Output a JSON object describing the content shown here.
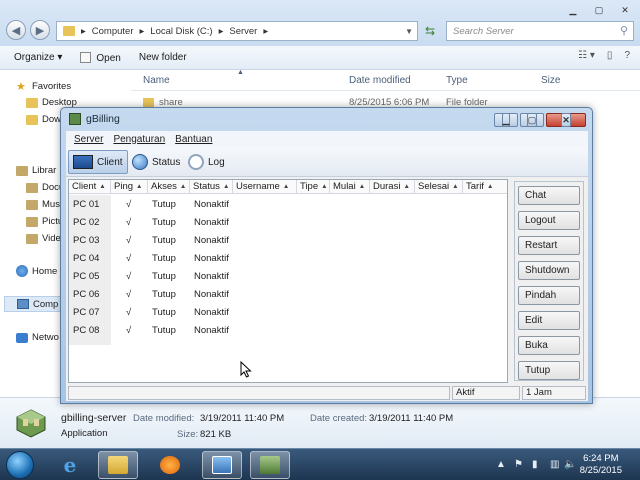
{
  "explorer": {
    "address": [
      "Computer",
      "Local Disk (C:)",
      "Server"
    ],
    "search_placeholder": "Search Server",
    "toolbar": {
      "organize": "Organize",
      "open": "Open",
      "new_folder": "New folder"
    },
    "columns": {
      "name": "Name",
      "date": "Date modified",
      "type": "Type",
      "size": "Size"
    },
    "file": {
      "name": "share",
      "date": "8/25/2015 6:06 PM",
      "type": "File folder"
    },
    "nav": {
      "favorites": "Favorites",
      "desktop": "Desktop",
      "downloads": "Dow",
      "libraries": "Librar",
      "documents": "Docu",
      "music": "Musi",
      "pictures": "Pictu",
      "videos": "Vide",
      "homegroup": "Home",
      "computer": "Comp",
      "network": "Netwo"
    },
    "details": {
      "name": "gbilling-server",
      "kind": "Application",
      "modified_label": "Date modified:",
      "modified": "3/19/2011 11:40 PM",
      "created_label": "Date created:",
      "created": "3/19/2011 11:40 PM",
      "size_label": "Size:",
      "size": "821 KB"
    }
  },
  "gbilling": {
    "title": "gBilling",
    "menu": [
      "Server",
      "Pengaturan",
      "Bantuan"
    ],
    "toolbar": [
      "Client",
      "Status",
      "Log"
    ],
    "columns": [
      "Client",
      "Ping",
      "Akses",
      "Status",
      "Username",
      "Tipe",
      "Mulai",
      "Durasi",
      "Selesai",
      "Tarif"
    ],
    "rows": [
      {
        "client": "PC 01",
        "ping": "√",
        "akses": "Tutup",
        "status": "Nonaktif"
      },
      {
        "client": "PC 02",
        "ping": "√",
        "akses": "Tutup",
        "status": "Nonaktif"
      },
      {
        "client": "PC 03",
        "ping": "√",
        "akses": "Tutup",
        "status": "Nonaktif"
      },
      {
        "client": "PC 04",
        "ping": "√",
        "akses": "Tutup",
        "status": "Nonaktif"
      },
      {
        "client": "PC 05",
        "ping": "√",
        "akses": "Tutup",
        "status": "Nonaktif"
      },
      {
        "client": "PC 06",
        "ping": "√",
        "akses": "Tutup",
        "status": "Nonaktif"
      },
      {
        "client": "PC 07",
        "ping": "√",
        "akses": "Tutup",
        "status": "Nonaktif"
      },
      {
        "client": "PC 08",
        "ping": "√",
        "akses": "Tutup",
        "status": "Nonaktif"
      }
    ],
    "actions": [
      "Chat",
      "Logout",
      "Restart",
      "Shutdown",
      "Pindah",
      "Edit",
      "Buka",
      "Tutup"
    ],
    "statusbar": {
      "left": "",
      "mid": "Aktif",
      "right": "1 Jam"
    }
  },
  "taskbar": {
    "time": "6:24 PM",
    "date": "8/25/2015"
  }
}
